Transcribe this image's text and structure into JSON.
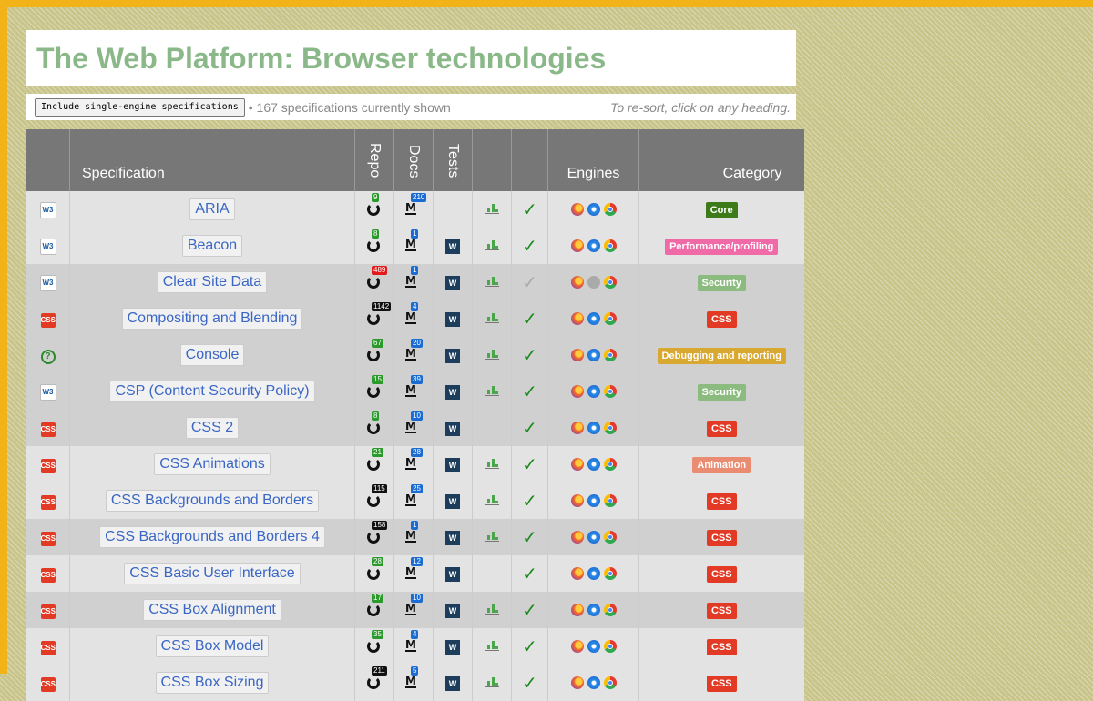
{
  "header": {
    "title": "The Web Platform: Browser technologies"
  },
  "toolbar": {
    "button_label": "Include single-engine specifications",
    "count_text": "• 167 specifications currently shown",
    "hint": "To re-sort, click on any heading."
  },
  "table": {
    "headers": {
      "spec": "Specification",
      "repo": "Repo",
      "docs": "Docs",
      "tests": "Tests",
      "engines": "Engines",
      "category": "Category"
    },
    "rows": [
      {
        "name": "ARIA",
        "org": "W3",
        "repo_count": "9",
        "repo_color": "green",
        "docs_count": "210",
        "tests": false,
        "chart": true,
        "check": true,
        "safari": true,
        "category": "Core",
        "cat_class": "badge-core"
      },
      {
        "name": "Beacon",
        "org": "W3",
        "repo_count": "8",
        "repo_color": "green",
        "docs_count": "1",
        "tests": true,
        "chart": true,
        "check": true,
        "safari": true,
        "category": "Performance/profiling",
        "cat_class": "badge-perf"
      },
      {
        "name": "Clear Site Data",
        "org": "W3",
        "repo_count": "489",
        "repo_color": "red",
        "docs_count": "1",
        "tests": true,
        "chart": true,
        "check": false,
        "safari": false,
        "category": "Security",
        "cat_class": "badge-security"
      },
      {
        "name": "Compositing and Blending",
        "org": "CSS",
        "repo_count": "1142",
        "repo_color": "black",
        "docs_count": "4",
        "tests": true,
        "chart": true,
        "check": true,
        "safari": true,
        "category": "CSS",
        "cat_class": "badge-css"
      },
      {
        "name": "Console",
        "org": "?",
        "repo_count": "67",
        "repo_color": "green",
        "docs_count": "20",
        "tests": true,
        "chart": true,
        "check": true,
        "safari": true,
        "category": "Debugging and reporting",
        "cat_class": "badge-debug"
      },
      {
        "name": "CSP (Content Security Policy)",
        "org": "W3",
        "repo_count": "15",
        "repo_color": "green",
        "docs_count": "39",
        "tests": true,
        "chart": true,
        "check": true,
        "safari": true,
        "category": "Security",
        "cat_class": "badge-security"
      },
      {
        "name": "CSS 2",
        "org": "CSS",
        "repo_count": "8",
        "repo_color": "green",
        "docs_count": "10",
        "tests": true,
        "chart": false,
        "check": true,
        "safari": true,
        "category": "CSS",
        "cat_class": "badge-css"
      },
      {
        "name": "CSS Animations",
        "org": "CSS",
        "repo_count": "21",
        "repo_color": "green",
        "docs_count": "28",
        "tests": true,
        "chart": true,
        "check": true,
        "safari": true,
        "category": "Animation",
        "cat_class": "badge-anim"
      },
      {
        "name": "CSS Backgrounds and Borders",
        "org": "CSS",
        "repo_count": "115",
        "repo_color": "black",
        "docs_count": "25",
        "tests": true,
        "chart": true,
        "check": true,
        "safari": true,
        "category": "CSS",
        "cat_class": "badge-css"
      },
      {
        "name": "CSS Backgrounds and Borders 4",
        "org": "CSS",
        "repo_count": "158",
        "repo_color": "black",
        "docs_count": "1",
        "tests": true,
        "chart": true,
        "check": true,
        "safari": true,
        "category": "CSS",
        "cat_class": "badge-css"
      },
      {
        "name": "CSS Basic User Interface",
        "org": "CSS",
        "repo_count": "28",
        "repo_color": "green",
        "docs_count": "12",
        "tests": true,
        "chart": false,
        "check": true,
        "safari": true,
        "category": "CSS",
        "cat_class": "badge-css"
      },
      {
        "name": "CSS Box Alignment",
        "org": "CSS",
        "repo_count": "17",
        "repo_color": "green",
        "docs_count": "10",
        "tests": true,
        "chart": true,
        "check": true,
        "safari": true,
        "category": "CSS",
        "cat_class": "badge-css"
      },
      {
        "name": "CSS Box Model",
        "org": "CSS",
        "repo_count": "35",
        "repo_color": "green",
        "docs_count": "4",
        "tests": true,
        "chart": true,
        "check": true,
        "safari": true,
        "category": "CSS",
        "cat_class": "badge-css"
      },
      {
        "name": "CSS Box Sizing",
        "org": "CSS",
        "repo_count": "211",
        "repo_color": "black",
        "docs_count": "5",
        "tests": true,
        "chart": true,
        "check": true,
        "safari": true,
        "category": "CSS",
        "cat_class": "badge-css"
      }
    ],
    "row_bands": [
      "g0",
      "g0",
      "g1",
      "g1",
      "g1",
      "g1",
      "g1",
      "g0",
      "g0",
      "g1",
      "g0",
      "g1",
      "g0",
      "g0"
    ]
  }
}
